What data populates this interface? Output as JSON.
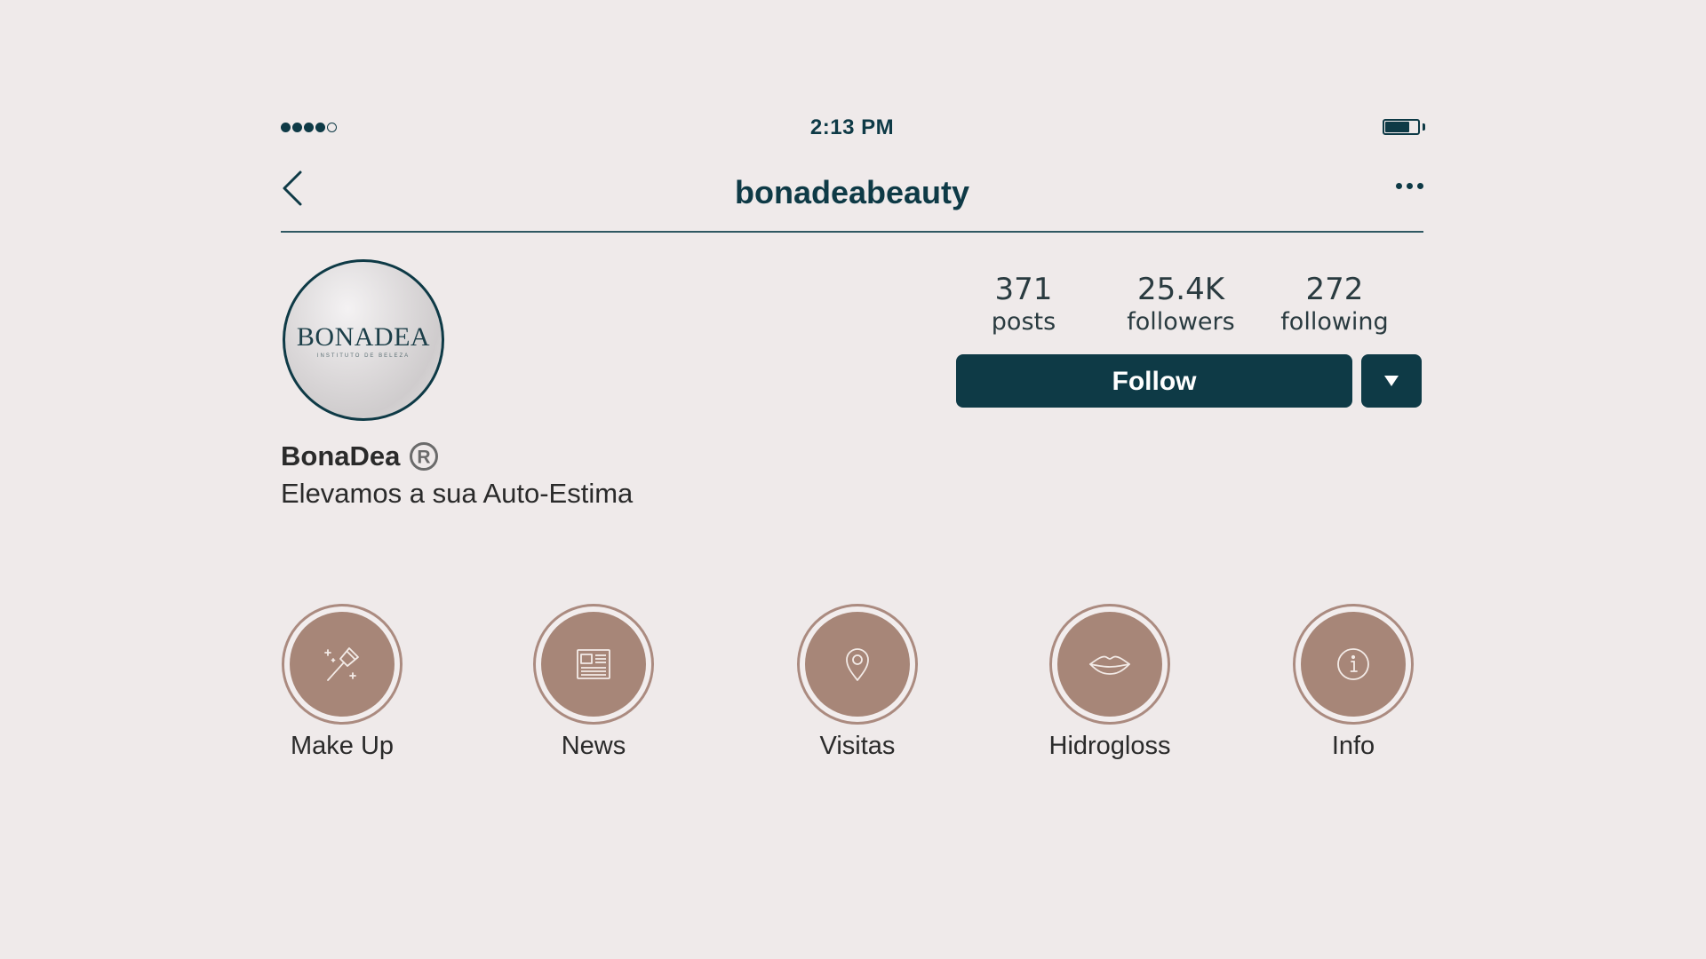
{
  "status_bar": {
    "time": "2:13 PM",
    "signal_bars_filled": 4,
    "signal_bars_total": 5,
    "battery_level_fraction": 0.65
  },
  "nav": {
    "title": "bonadeabeauty",
    "back_icon": "chevron-left-icon",
    "more_icon": "more-horizontal-icon"
  },
  "avatar": {
    "logo_text": "BONADEA",
    "tagline": "INSTITUTO DE BELEZA"
  },
  "stats": [
    {
      "value": "371",
      "label": "posts"
    },
    {
      "value": "25.4K",
      "label": "followers"
    },
    {
      "value": "272",
      "label": "following"
    }
  ],
  "actions": {
    "follow_label": "Follow",
    "dropdown_icon": "caret-down-icon"
  },
  "profile": {
    "name": "BonaDea",
    "badge_icon": "registered-icon",
    "bio": "Elevamos a sua Auto-Estima"
  },
  "highlights": [
    {
      "label": "Make Up",
      "icon": "makeup-brush-icon"
    },
    {
      "label": "News",
      "icon": "newspaper-icon"
    },
    {
      "label": "Visitas",
      "icon": "location-pin-icon"
    },
    {
      "label": "Hidrogloss",
      "icon": "lips-icon"
    },
    {
      "label": "Info",
      "icon": "info-icon"
    }
  ],
  "colors": {
    "background": "#efeaea",
    "primary": "#0e3a46",
    "highlight_fill": "#a78678",
    "highlight_ring": "#ab8b80",
    "text": "#2a2a2a"
  }
}
